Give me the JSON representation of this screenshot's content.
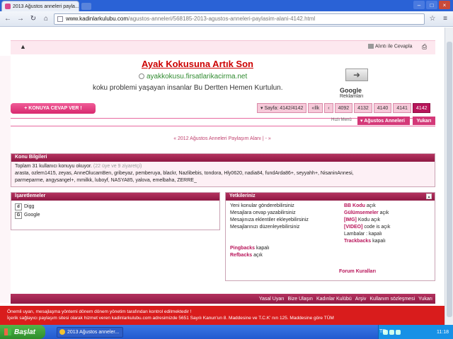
{
  "browser": {
    "tab_title": "2013 Ağustos anneleri payla...",
    "tab_close": "×",
    "url_domain": "www.kadinlarkulubu.com",
    "url_path": "/agustos-anneleri/568185-2013-agustos-anneleri-paylasim-alani-4142.html",
    "min": "–",
    "max": "□",
    "close": "×",
    "back": "←",
    "forward": "→",
    "reload": "↻",
    "home": "⌂",
    "star": "☆",
    "wrench": "≡"
  },
  "topbar": {
    "warn": "▲",
    "quote_reply": "Alıntı ile Cevapla",
    "print": "⎙"
  },
  "ad": {
    "title": "Ayak Kokusuna Artık Son",
    "url": "ayakkokusu.firsatlarikacirma.net",
    "desc": "koku problemi yaşayan insanlar Bu Dertten Hemen Kurtulun.",
    "arrow": "➜",
    "google": "Google",
    "google_suffix": "Reklamları"
  },
  "reply_button": "+ KONUYA CEVAP VER !",
  "pager": [
    "▾ Sayfa: 4142/4142",
    "«İlk",
    "‹",
    "4092",
    "4132",
    "4140",
    "4141",
    "4142"
  ],
  "quick": {
    "label": "Hızlı Menü",
    "tab1": "▾ Ağustos Anneleri",
    "tab2": "Yukarı"
  },
  "threadnav": "« 2012 Ağustos Anneleri Paylaşım Alanı | - »",
  "info": {
    "head": "Konu Bilgileri",
    "line1": "Toplam 31 kullanıcı konuyu okuyor.",
    "line1_gray": "(22 üye ve 9 ziyaretçi)",
    "line2": "arasta, ozlem1415, zeyas, AnneOlucamBen, gribeyaz, pemberuya, blackr, Nazlibebis, tondora, Hly0620, nadia84, fundArda86+, seyyahh+, NisaninAnnesi,",
    "line3": "parmeparme, angysangel+, mmilkk, luboyf, NASYA85, yalova, emelbaha, ZERRE_"
  },
  "bookmarks": {
    "head": "İşaretlemeler",
    "items": [
      {
        "icon": "d",
        "label": "Digg"
      },
      {
        "icon": "G",
        "label": "Google"
      }
    ]
  },
  "perms": {
    "head": "Yetkileriniz",
    "expand": "▴",
    "left": [
      "Yeni konular gönderebilirsiniz",
      "Mesajlara cevap yazabilirsiniz",
      "Mesajınıza eklentiler ekleyebilirsiniz",
      "Mesajlarınızı düzenleyebilirsiniz"
    ],
    "right": [
      {
        "link": "BB Kodu",
        "state": "açık"
      },
      {
        "link": "Gülümsemeler",
        "state": "açık"
      },
      {
        "link": "[IMG]",
        "state": "Kodu açık"
      },
      {
        "link": "[VIDEO]",
        "state": "code is açık"
      },
      {
        "link": "",
        "state": "Lambalar : kapalı"
      },
      {
        "link": "Trackbacks",
        "state": "kapalı"
      }
    ],
    "pingbacks": "Pingbacks",
    "pingbacks_state": "kapalı",
    "refbacks": "Refbacks",
    "refbacks_state": "açık",
    "rules": "Forum Kuralları"
  },
  "footer": [
    "Yasal Uyarı",
    "Bize Ulaşın",
    "Kadınlar Kulübü",
    "Arşiv",
    "Kullanım sözleşmesi",
    "Yukarı"
  ],
  "notice": {
    "line1": "Önemli uyarı, mesajlaşma yöntemi dönem dönem yönetim tarafından kontrol edilmektedir !",
    "line2": "İçerik sağlayıcı paylaşım sitesi olarak hizmet veren kadinlarkulubu.com adresimizde 5651 Sayılı Kanun'un 8. Maddesine ve T.C.K' nın 125. Maddesine göre TÜM"
  },
  "taskbar": {
    "start": "Başlat",
    "task": "2013 Ağustos anneler...",
    "lang": "TR",
    "clock": "11:18"
  }
}
